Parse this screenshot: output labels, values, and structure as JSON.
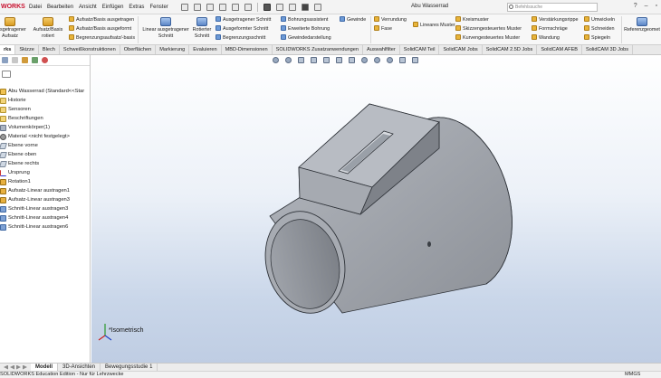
{
  "app": {
    "brand": "WORKS",
    "document_title": "Abu Wasserrad",
    "search_placeholder": "Befehlssuche"
  },
  "menu": [
    "Datei",
    "Bearbeiten",
    "Ansicht",
    "Einfügen",
    "Extras",
    "Fenster"
  ],
  "ribbon": {
    "aufsatz_big": "ausgetragener\nAufsatz",
    "aufsatz_rotiert": "Aufsatz/Basis\nrotiert",
    "aufsatz_ausgetragen": "Aufsatz/Basis ausgetragen",
    "aufsatz_ausgeformt": "Aufsatz/Basis ausgeformt",
    "begrenzung_aufsatz": "Begrenzungsaufsatz/-basis",
    "linear_schnitt": "Linear ausgetragener\nSchnitt",
    "rotierter_schnitt": "Rotierter\nSchnitt",
    "ausgetragener_schnitt": "Ausgetragener Schnitt",
    "ausgeformter_schnitt": "Ausgeformter Schnitt",
    "begrenzungsschnitt": "Begrenzungsschnitt",
    "bohrungsassistent": "Bohrungsassistent",
    "erweiterte_bohrung": "Erweiterte Bohrung",
    "gewindedarstellung": "Gewindedarstellung",
    "gewinde": "Gewinde",
    "verrundung": "Verrundung",
    "fase": "Fase",
    "lineares_muster": "Lineares Muster",
    "kreismuster": "Kreismuster",
    "skizzenmuster": "Skizzengesteuertes Muster",
    "kurvenmuster": "Kurvengesteuertes Muster",
    "verstaerkungsrippe": "Verstärkungsrippe",
    "formschraege": "Formschräge",
    "wandung": "Wandung",
    "umwickeln": "Umwickeln",
    "schneiden": "Schneiden",
    "spiegeln": "Spiegeln",
    "referenzgeometrie": "Referenzgeomet"
  },
  "tabs": [
    "rks",
    "Skizze",
    "Blech",
    "Schweißkonstruktionen",
    "Oberflächen",
    "Markierung",
    "Evaluieren",
    "MBD-Dimensionen",
    "SOLIDWORKS Zusatzanwendungen",
    "Auswahlfilter",
    "SolidCAM Teil",
    "SolidCAM Jobs",
    "SolidCAM 2.5D Jobs",
    "SolidCAM AFEB",
    "SolidCAM 3D Jobs"
  ],
  "tree": [
    {
      "label": "Abu Wasserrad  (Standard<<Star",
      "icon": "part"
    },
    {
      "label": "Historie",
      "icon": "folder"
    },
    {
      "label": "Sensoren",
      "icon": "folder"
    },
    {
      "label": "Beschriftungen",
      "icon": "folder"
    },
    {
      "label": "Volumenkörper(1)",
      "icon": "body"
    },
    {
      "label": "Material <nicht festgelegt>",
      "icon": "mat"
    },
    {
      "label": "Ebene vorne",
      "icon": "plane"
    },
    {
      "label": "Ebene oben",
      "icon": "plane"
    },
    {
      "label": "Ebene rechts",
      "icon": "plane"
    },
    {
      "label": "Ursprung",
      "icon": "origin"
    },
    {
      "label": "Rotation1",
      "icon": "feat"
    },
    {
      "label": "Aufsatz-Linear austragen1",
      "icon": "feat"
    },
    {
      "label": "Aufsatz-Linear austragen3",
      "icon": "feat"
    },
    {
      "label": "Schnitt-Linear austragen3",
      "icon": "feat"
    },
    {
      "label": "Schnitt-Linear austragen4",
      "icon": "feat"
    },
    {
      "label": "Schnitt-Linear austragen6",
      "icon": "feat"
    }
  ],
  "view": {
    "orientation_label": "*Isometrisch"
  },
  "bottom_tabs": [
    "Modell",
    "3D-Ansichten",
    "Bewegungsstudie 1"
  ],
  "status": {
    "left": "SOLIDWORKS Education Edition - Nur für Lehrzwecke",
    "right": "MMGS"
  },
  "colors": {
    "brand": "#c8102e",
    "model_face": "#9ea3ab",
    "model_shadow": "#7f848c",
    "viewport_bottom": "#bfcde3"
  }
}
